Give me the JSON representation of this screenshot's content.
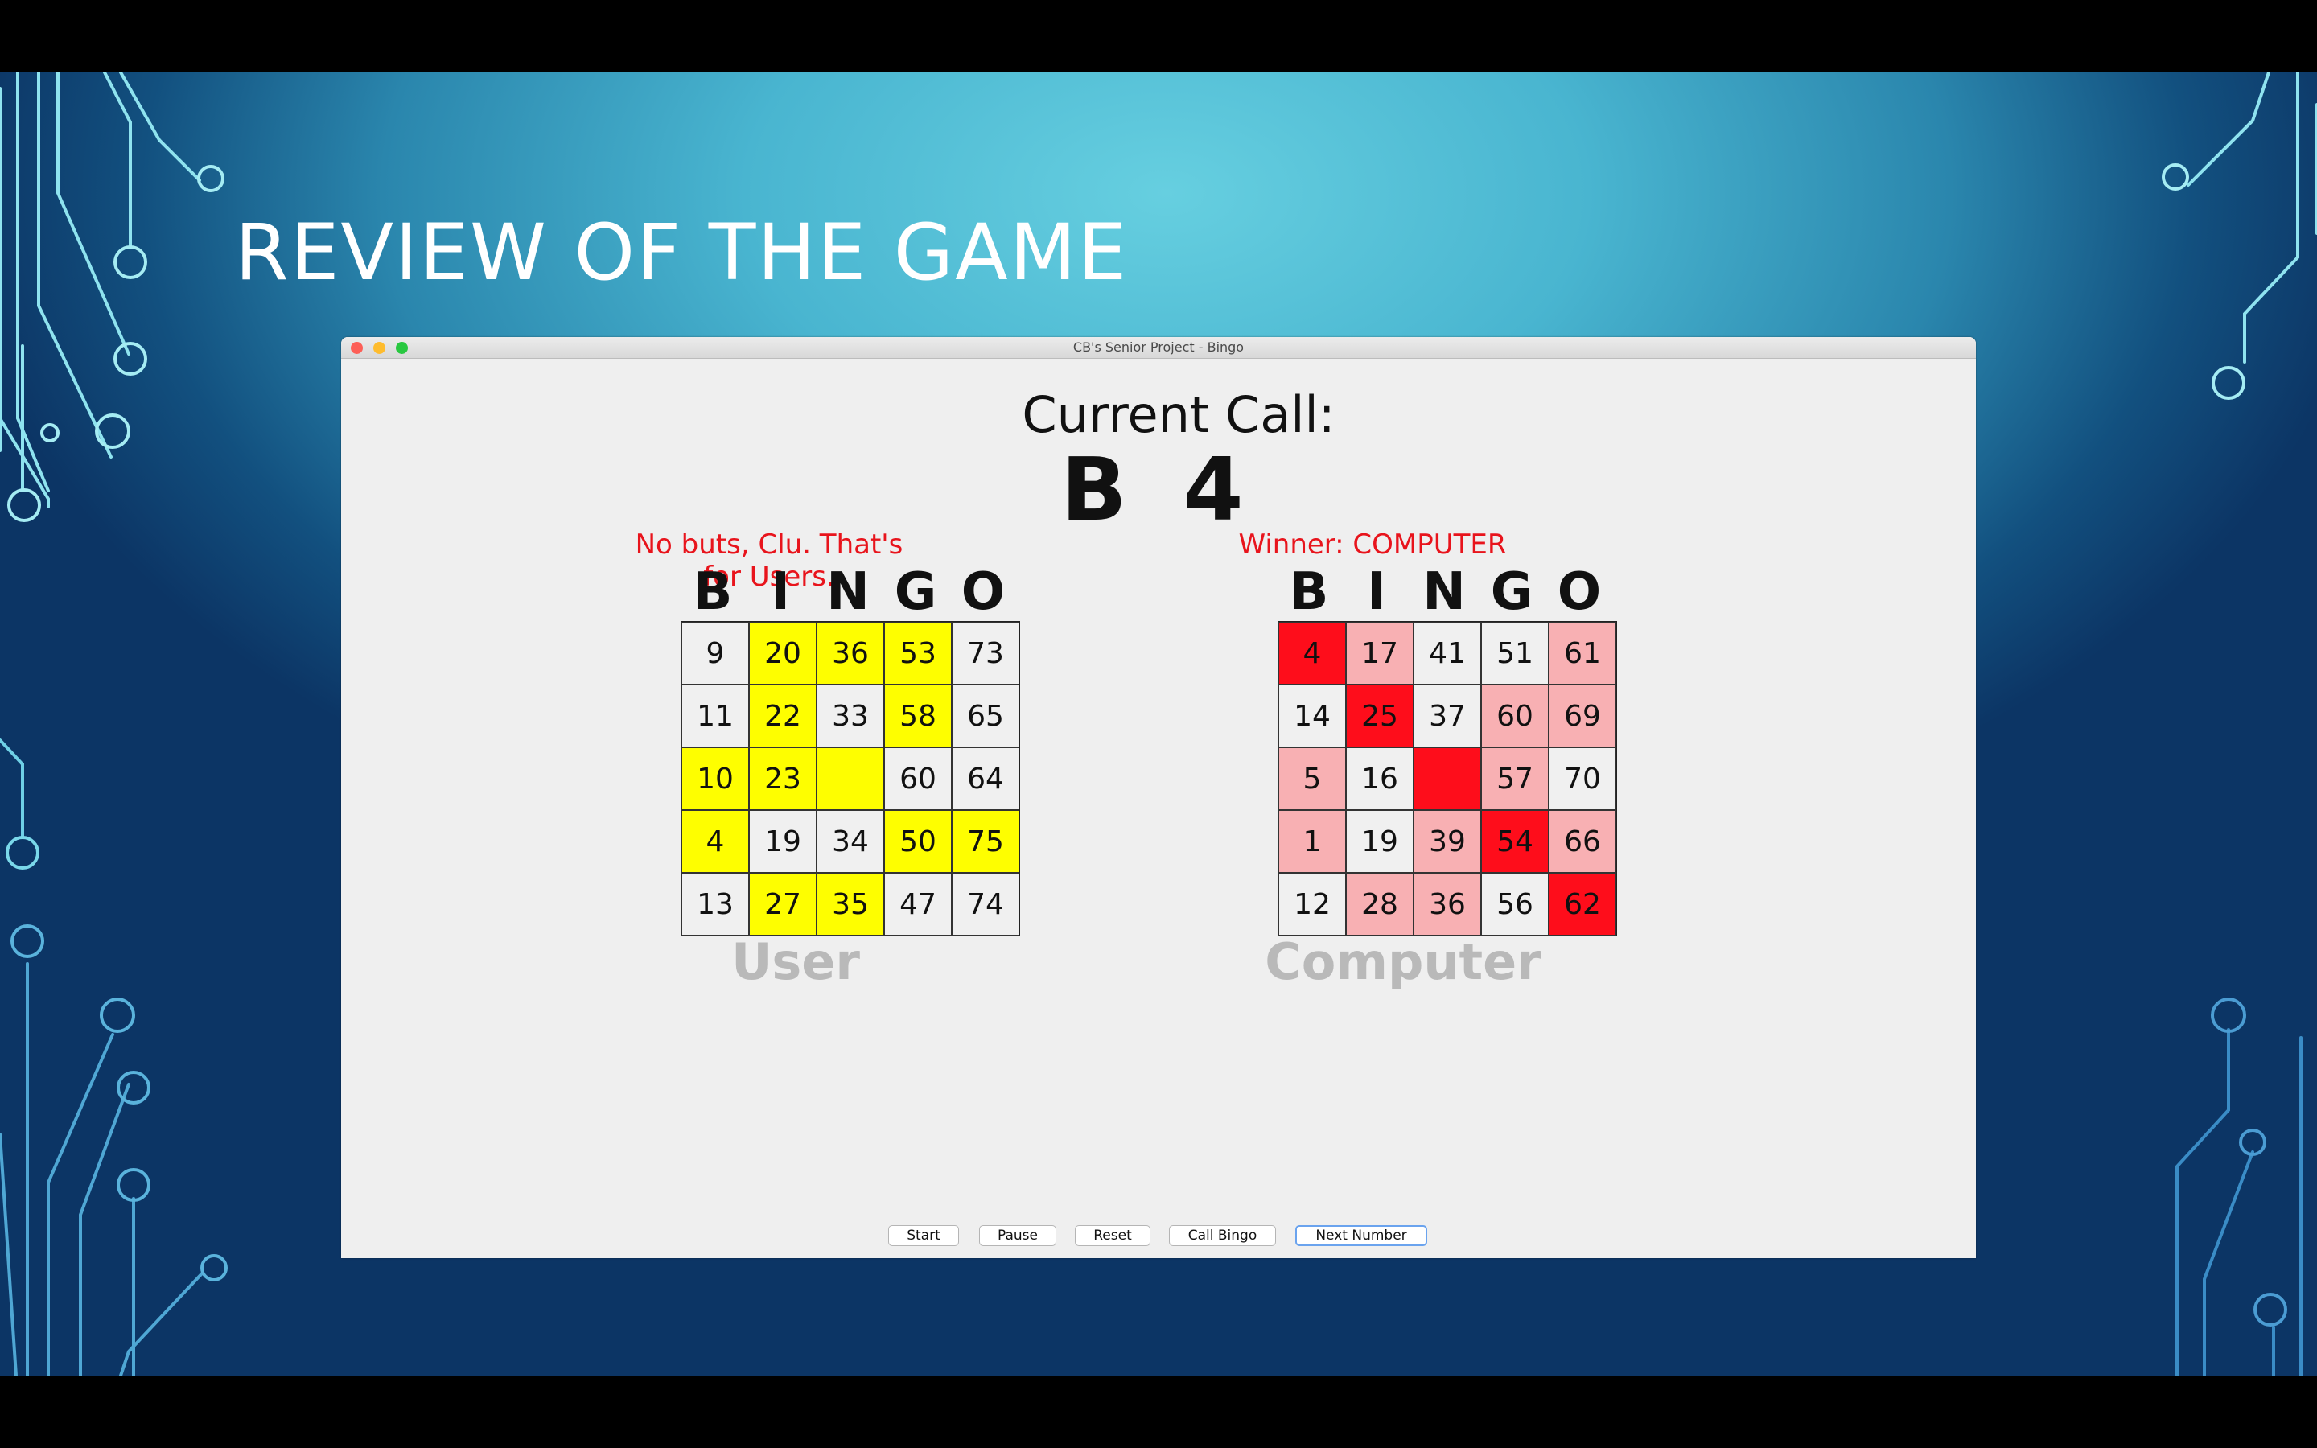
{
  "slide": {
    "title": "REVIEW OF THE GAME"
  },
  "window": {
    "title": "CB's Senior Project - Bingo"
  },
  "current_call": {
    "label": "Current Call:",
    "value": "B 4"
  },
  "user": {
    "message": "No buts, Clu. That's for Users.",
    "header": [
      "B",
      "I",
      "N",
      "G",
      "O"
    ],
    "label": "User",
    "cells": [
      [
        {
          "v": "9",
          "s": "none"
        },
        {
          "v": "20",
          "s": "yellow"
        },
        {
          "v": "36",
          "s": "yellow"
        },
        {
          "v": "53",
          "s": "yellow"
        },
        {
          "v": "73",
          "s": "none"
        }
      ],
      [
        {
          "v": "11",
          "s": "none"
        },
        {
          "v": "22",
          "s": "yellow"
        },
        {
          "v": "33",
          "s": "none"
        },
        {
          "v": "58",
          "s": "yellow"
        },
        {
          "v": "65",
          "s": "none"
        }
      ],
      [
        {
          "v": "10",
          "s": "yellow"
        },
        {
          "v": "23",
          "s": "yellow"
        },
        {
          "v": "",
          "s": "yellow"
        },
        {
          "v": "60",
          "s": "none"
        },
        {
          "v": "64",
          "s": "none"
        }
      ],
      [
        {
          "v": "4",
          "s": "yellow"
        },
        {
          "v": "19",
          "s": "none"
        },
        {
          "v": "34",
          "s": "none"
        },
        {
          "v": "50",
          "s": "yellow"
        },
        {
          "v": "75",
          "s": "yellow"
        }
      ],
      [
        {
          "v": "13",
          "s": "none"
        },
        {
          "v": "27",
          "s": "yellow"
        },
        {
          "v": "35",
          "s": "yellow"
        },
        {
          "v": "47",
          "s": "none"
        },
        {
          "v": "74",
          "s": "none"
        }
      ]
    ]
  },
  "computer": {
    "message": "Winner: COMPUTER",
    "header": [
      "B",
      "I",
      "N",
      "G",
      "O"
    ],
    "label": "Computer",
    "cells": [
      [
        {
          "v": "4",
          "s": "red"
        },
        {
          "v": "17",
          "s": "pink"
        },
        {
          "v": "41",
          "s": "none"
        },
        {
          "v": "51",
          "s": "none"
        },
        {
          "v": "61",
          "s": "pink"
        }
      ],
      [
        {
          "v": "14",
          "s": "none"
        },
        {
          "v": "25",
          "s": "red"
        },
        {
          "v": "37",
          "s": "none"
        },
        {
          "v": "60",
          "s": "pink"
        },
        {
          "v": "69",
          "s": "pink"
        }
      ],
      [
        {
          "v": "5",
          "s": "pink"
        },
        {
          "v": "16",
          "s": "none"
        },
        {
          "v": "",
          "s": "red"
        },
        {
          "v": "57",
          "s": "pink"
        },
        {
          "v": "70",
          "s": "none"
        }
      ],
      [
        {
          "v": "1",
          "s": "pink"
        },
        {
          "v": "19",
          "s": "none"
        },
        {
          "v": "39",
          "s": "pink"
        },
        {
          "v": "54",
          "s": "red"
        },
        {
          "v": "66",
          "s": "pink"
        }
      ],
      [
        {
          "v": "12",
          "s": "none"
        },
        {
          "v": "28",
          "s": "pink"
        },
        {
          "v": "36",
          "s": "pink"
        },
        {
          "v": "56",
          "s": "none"
        },
        {
          "v": "62",
          "s": "red"
        }
      ]
    ]
  },
  "buttons": {
    "start": "Start",
    "pause": "Pause",
    "reset": "Reset",
    "call_bingo": "Call Bingo",
    "next_number": "Next Number"
  },
  "colors": {
    "marked_user": "#fefe00",
    "marked_computer": "#f8b0b3",
    "winning_line": "#fe0d1b",
    "message": "#e8141c",
    "label_gray": "#b9b9b9"
  }
}
